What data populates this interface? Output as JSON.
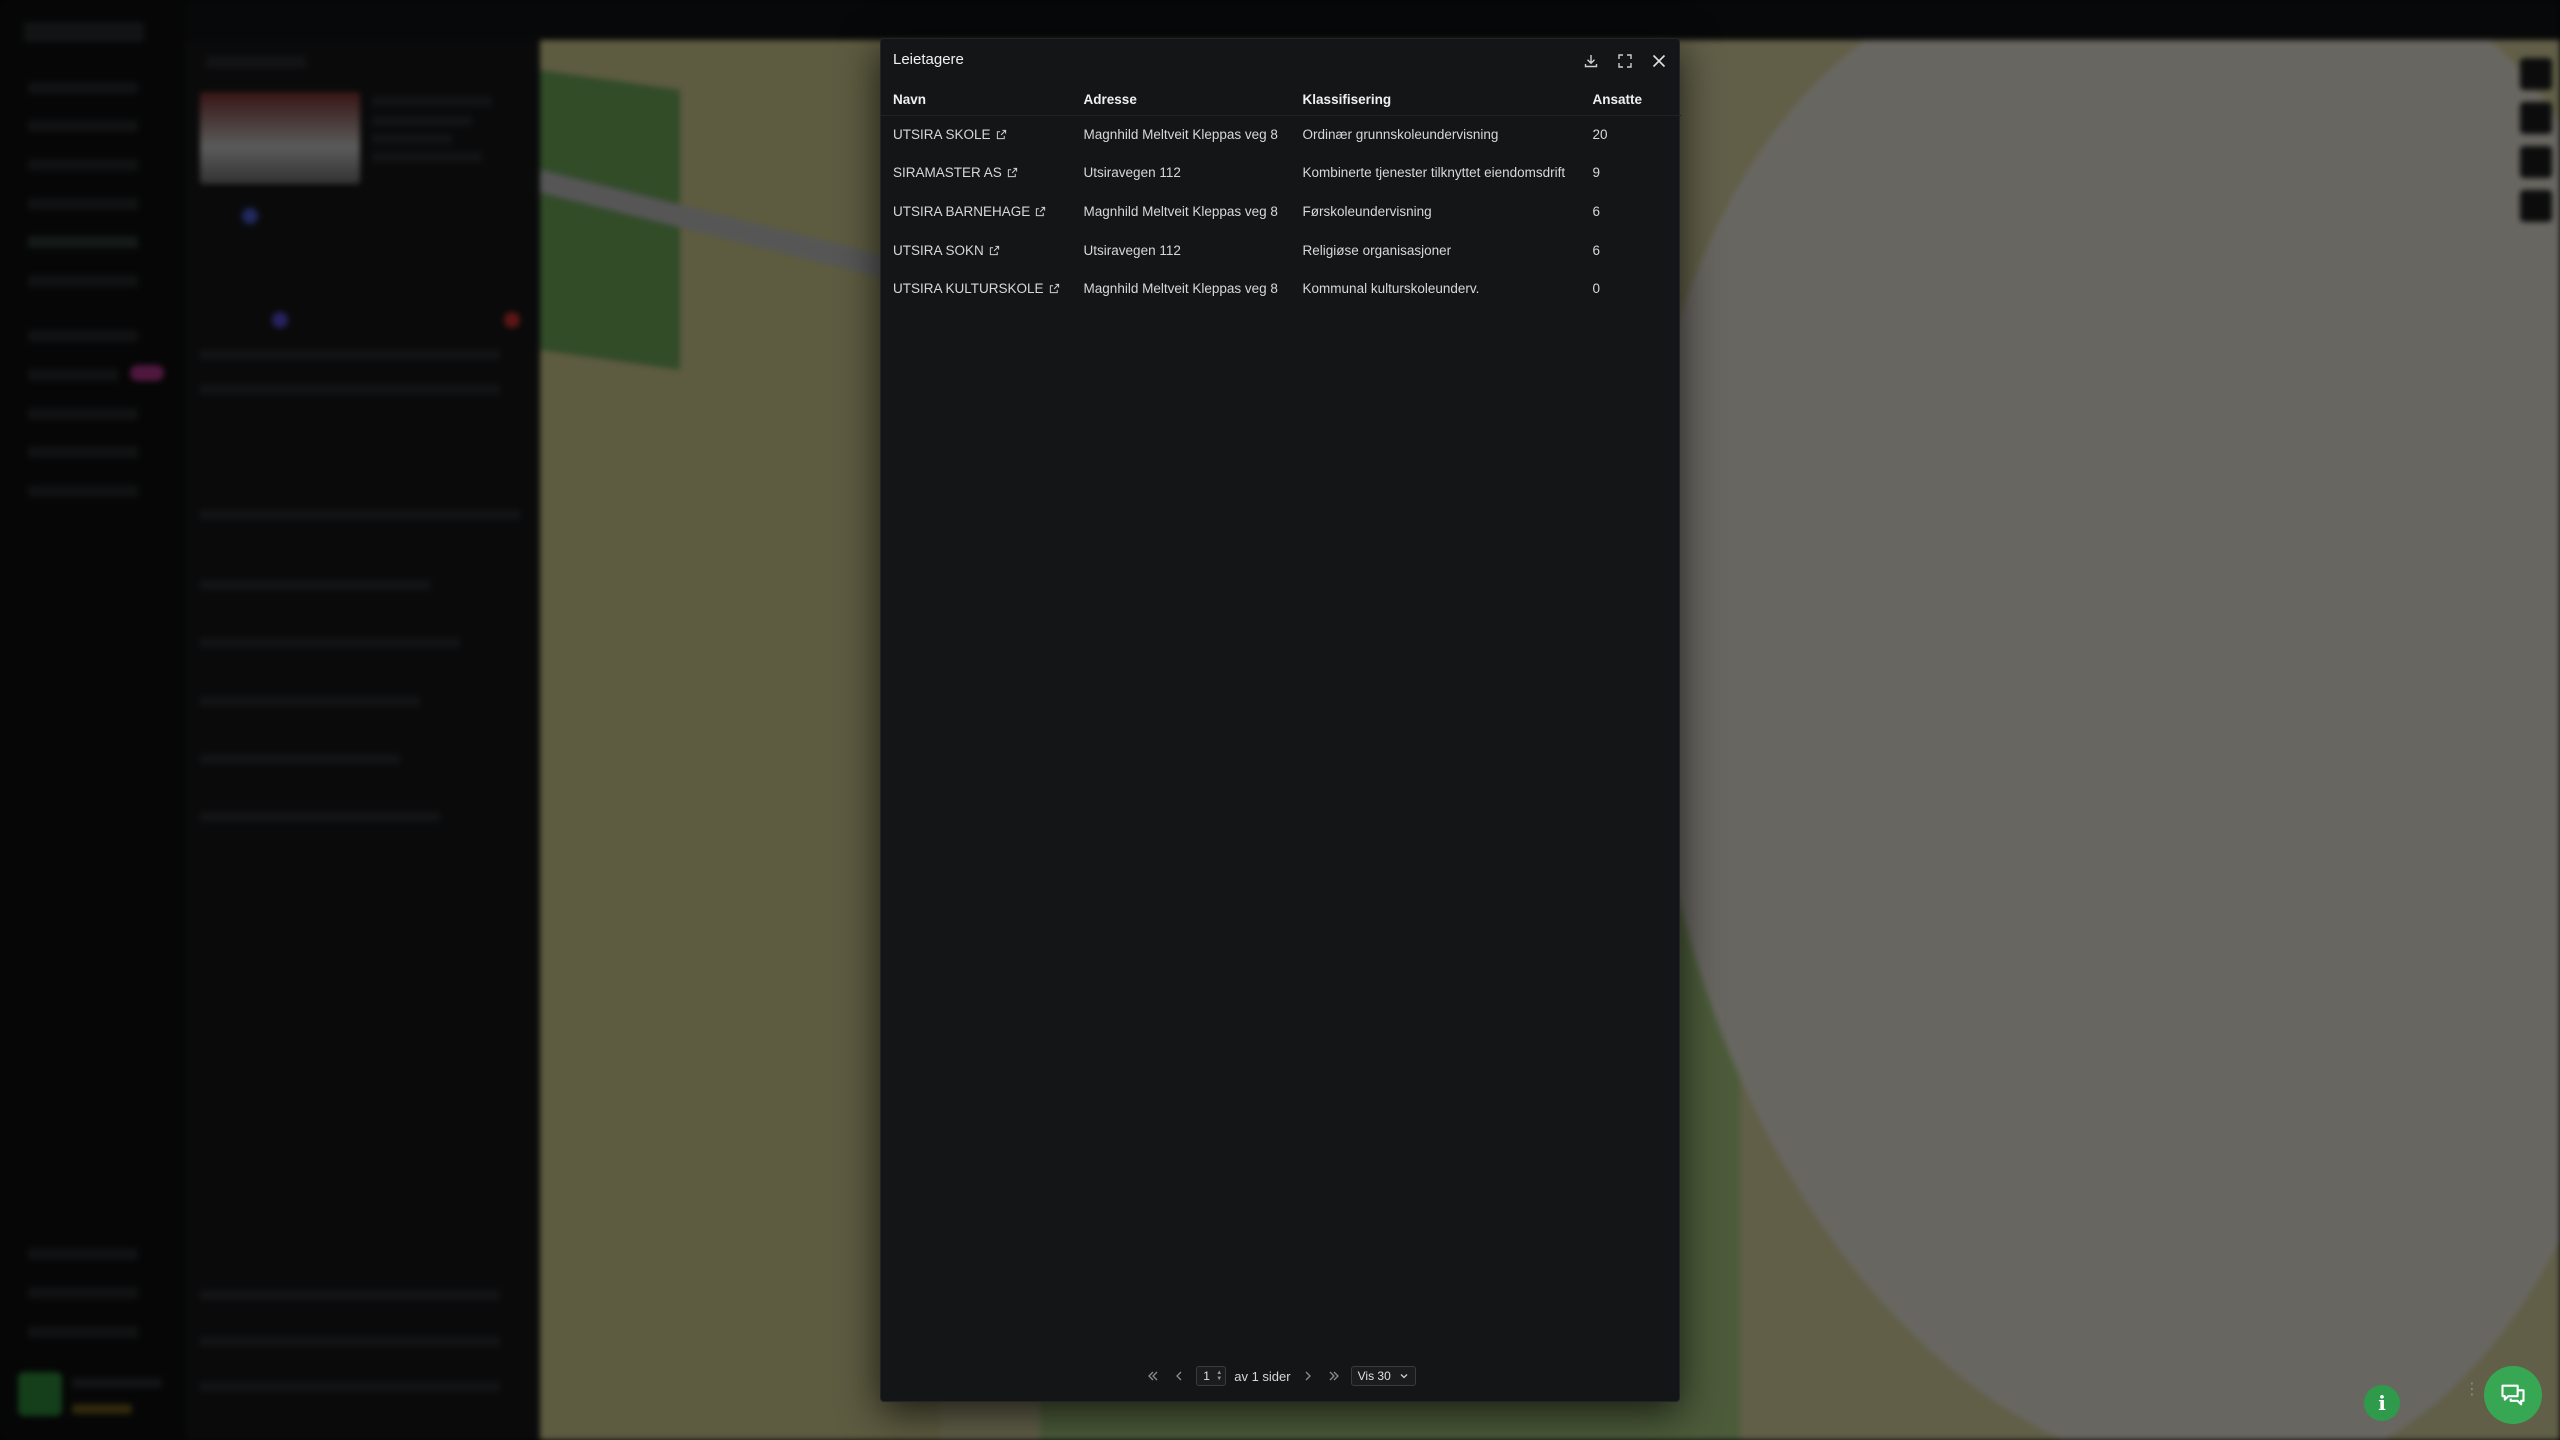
{
  "modal": {
    "title": "Leietagere",
    "actions": [
      {
        "name": "download-icon"
      },
      {
        "name": "fullscreen-icon"
      },
      {
        "name": "close-icon"
      }
    ]
  },
  "table": {
    "columns": [
      "Navn",
      "Adresse",
      "Klassifisering",
      "Ansatte"
    ],
    "rows": [
      {
        "navn": "UTSIRA SKOLE",
        "adresse": "Magnhild Meltveit Kleppas veg 8",
        "klassifisering": "Ordinær grunnskoleundervisning",
        "ansatte": "20"
      },
      {
        "navn": "SIRAMASTER AS",
        "adresse": "Utsiravegen 112",
        "klassifisering": "Kombinerte tjenester tilknyttet eiendomsdrift",
        "ansatte": "9"
      },
      {
        "navn": "UTSIRA BARNEHAGE",
        "adresse": "Magnhild Meltveit Kleppas veg 8",
        "klassifisering": "Førskoleundervisning",
        "ansatte": "6"
      },
      {
        "navn": "UTSIRA SOKN",
        "adresse": "Utsiravegen 112",
        "klassifisering": "Religiøse organisasjoner",
        "ansatte": "6"
      },
      {
        "navn": "UTSIRA KULTURSKOLE",
        "adresse": "Magnhild Meltveit Kleppas veg 8",
        "klassifisering": "Kommunal kulturskoleunderv.",
        "ansatte": "0"
      }
    ]
  },
  "pagination": {
    "current_page": "1",
    "of_pages_label": "av 1 sider",
    "page_size_label": "Vis 30"
  },
  "colors": {
    "accent_green": "#38a753",
    "modal_bg": "#141517"
  }
}
